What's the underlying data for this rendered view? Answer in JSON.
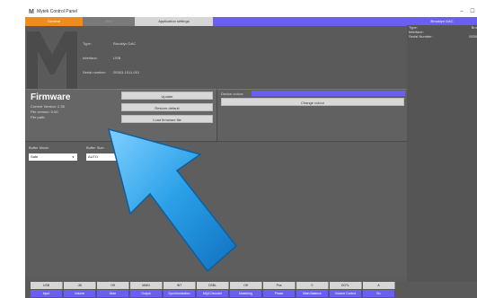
{
  "window": {
    "title": "Mytek Control Panel",
    "minimize": "–",
    "maximize": "☐"
  },
  "tabs": [
    {
      "label": "General"
    },
    {
      "label": "Rtst"
    },
    {
      "label": "Application settings"
    }
  ],
  "device": {
    "type_label": "Type:",
    "type_value": "Brooklyn DAC",
    "interface_label": "Interface:",
    "interface_value": "USB",
    "serial_label": "Serial number:",
    "serial_value": "05303-1511-001"
  },
  "firmware": {
    "title": "Firmware",
    "current_version": "Current Version: 2.35",
    "file_version": "File version: 0.00",
    "file_path": "File path:",
    "update_label": "Update",
    "restore_label": "Restore default",
    "load_label": "Load firmware file"
  },
  "colour": {
    "label": "Device colour:",
    "change_label": "Change colour",
    "value_color": "#6a5ff0"
  },
  "buffer": {
    "mode_label": "Buffer Mode:",
    "mode_value": "Safe",
    "size_label": "Buffer Size:",
    "size_value": "AUTO"
  },
  "right_panel": {
    "header": "Brooklyn DAC",
    "type_label": "Type:",
    "type_value": "Bro",
    "interface_label": "Interface:",
    "serial_label": "Serial Number:",
    "serial_value": "0530"
  },
  "status": {
    "values": [
      "USB",
      "-36",
      "Off",
      "MAIN",
      "INT",
      "DSBL",
      "Off",
      "Pos",
      "0",
      "DOTL",
      "A"
    ],
    "labels": [
      "Input",
      "Volume",
      "Mute",
      "Output",
      "Synchronization",
      "MQA Decoder",
      "Mastering",
      "Phase",
      "Main Balance",
      "Volume Control",
      "Bu"
    ]
  },
  "colors": {
    "accent": "#6a5ff0",
    "tab_active": "#f08c1e",
    "arrow": "#2aa0e8"
  }
}
